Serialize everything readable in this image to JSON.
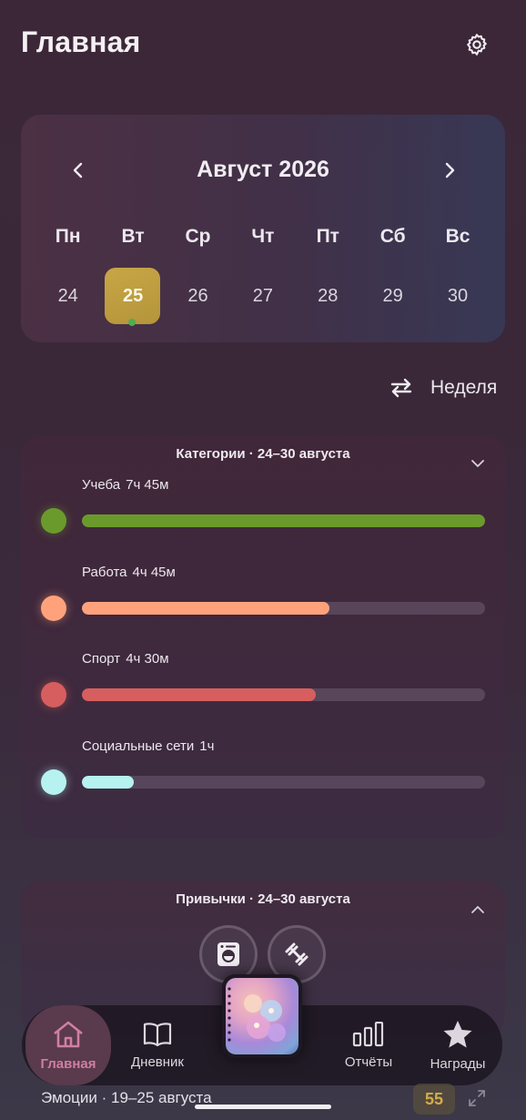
{
  "header": {
    "title": "Главная",
    "settings_icon": "gear-icon"
  },
  "calendar": {
    "month_label": "Август 2026",
    "weekdays": [
      "Пн",
      "Вт",
      "Ср",
      "Чт",
      "Пт",
      "Сб",
      "Вс"
    ],
    "days": [
      "24",
      "25",
      "26",
      "27",
      "28",
      "29",
      "30"
    ],
    "selected_day": "25",
    "selected_color": "#c0a040",
    "event_dot_color": "#4caf50"
  },
  "view_toggle": {
    "label": "Неделя",
    "icon": "swap-arrows-icon"
  },
  "categories": {
    "title": "Категории · 24–30 августа",
    "items": [
      {
        "name": "Учеба",
        "duration": "7ч 45м",
        "fraction": 1.0,
        "color": "#6b9a2c"
      },
      {
        "name": "Работа",
        "duration": "4ч 45м",
        "fraction": 0.613,
        "color": "#ffa27c"
      },
      {
        "name": "Спорт",
        "duration": "4ч 30м",
        "fraction": 0.581,
        "color": "#d75e5e"
      },
      {
        "name": "Социальные сети",
        "duration": "1ч",
        "fraction": 0.129,
        "color": "#b6f2f0"
      }
    ]
  },
  "habits": {
    "title": "Привычки · 24–30 августа",
    "icons": [
      "washing-machine-icon",
      "dumbbell-icon"
    ]
  },
  "bottom_nav": {
    "items": [
      {
        "label": "Главная",
        "icon": "home-icon",
        "active": true
      },
      {
        "label": "Дневник",
        "icon": "book-icon",
        "active": false
      },
      {
        "label": "Отчёты",
        "icon": "bar-chart-icon",
        "active": false
      },
      {
        "label": "Награды",
        "icon": "star-icon",
        "active": false
      }
    ],
    "center_icon": "diary-cover-icon"
  },
  "emotions": {
    "title": "Эмоции · 19–25 августа",
    "score": "55",
    "score_color": "#d3ad48"
  }
}
